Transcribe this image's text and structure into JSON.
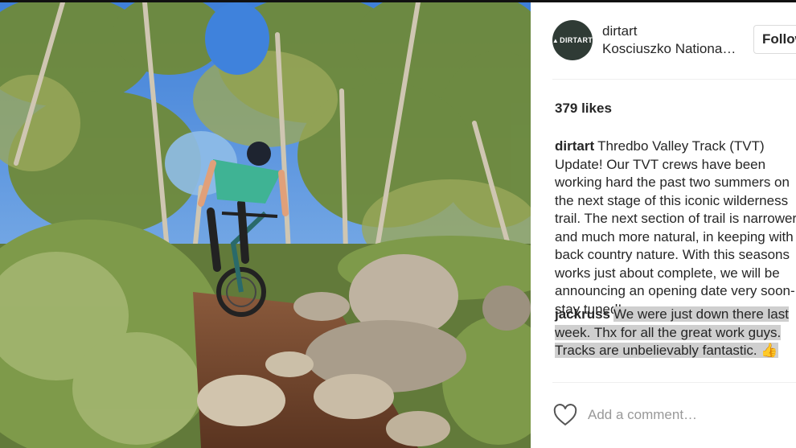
{
  "post": {
    "username": "dirtart",
    "avatar_text": "DIRTART",
    "location": "Kosciuszko National Park",
    "follow_label": "Follow",
    "likes": "379 likes",
    "caption": "Thredbo Valley Track (TVT) Update! Our TVT crews have been working hard the past two summers on the next stage of this iconic wilderness trail. The next section of trail is narrower and much more natural, in keeping with its back country nature. With this seasons works just about complete, we will be announcing an opening date very soon- stay tuned!",
    "comment": {
      "username": "jackruss",
      "text": "We were just down there last week. Thx for all the great work guys. Tracks are unbelievably fantastic. 👍"
    },
    "add_comment_placeholder": "Add a comment…"
  },
  "icons": {
    "like": "heart-outline-icon",
    "avatar_logo": "mountain-icon"
  },
  "colors": {
    "avatar_bg": "#2f3b35",
    "follow_border": "#dbdbdb",
    "selection": "#cfcfcf"
  }
}
